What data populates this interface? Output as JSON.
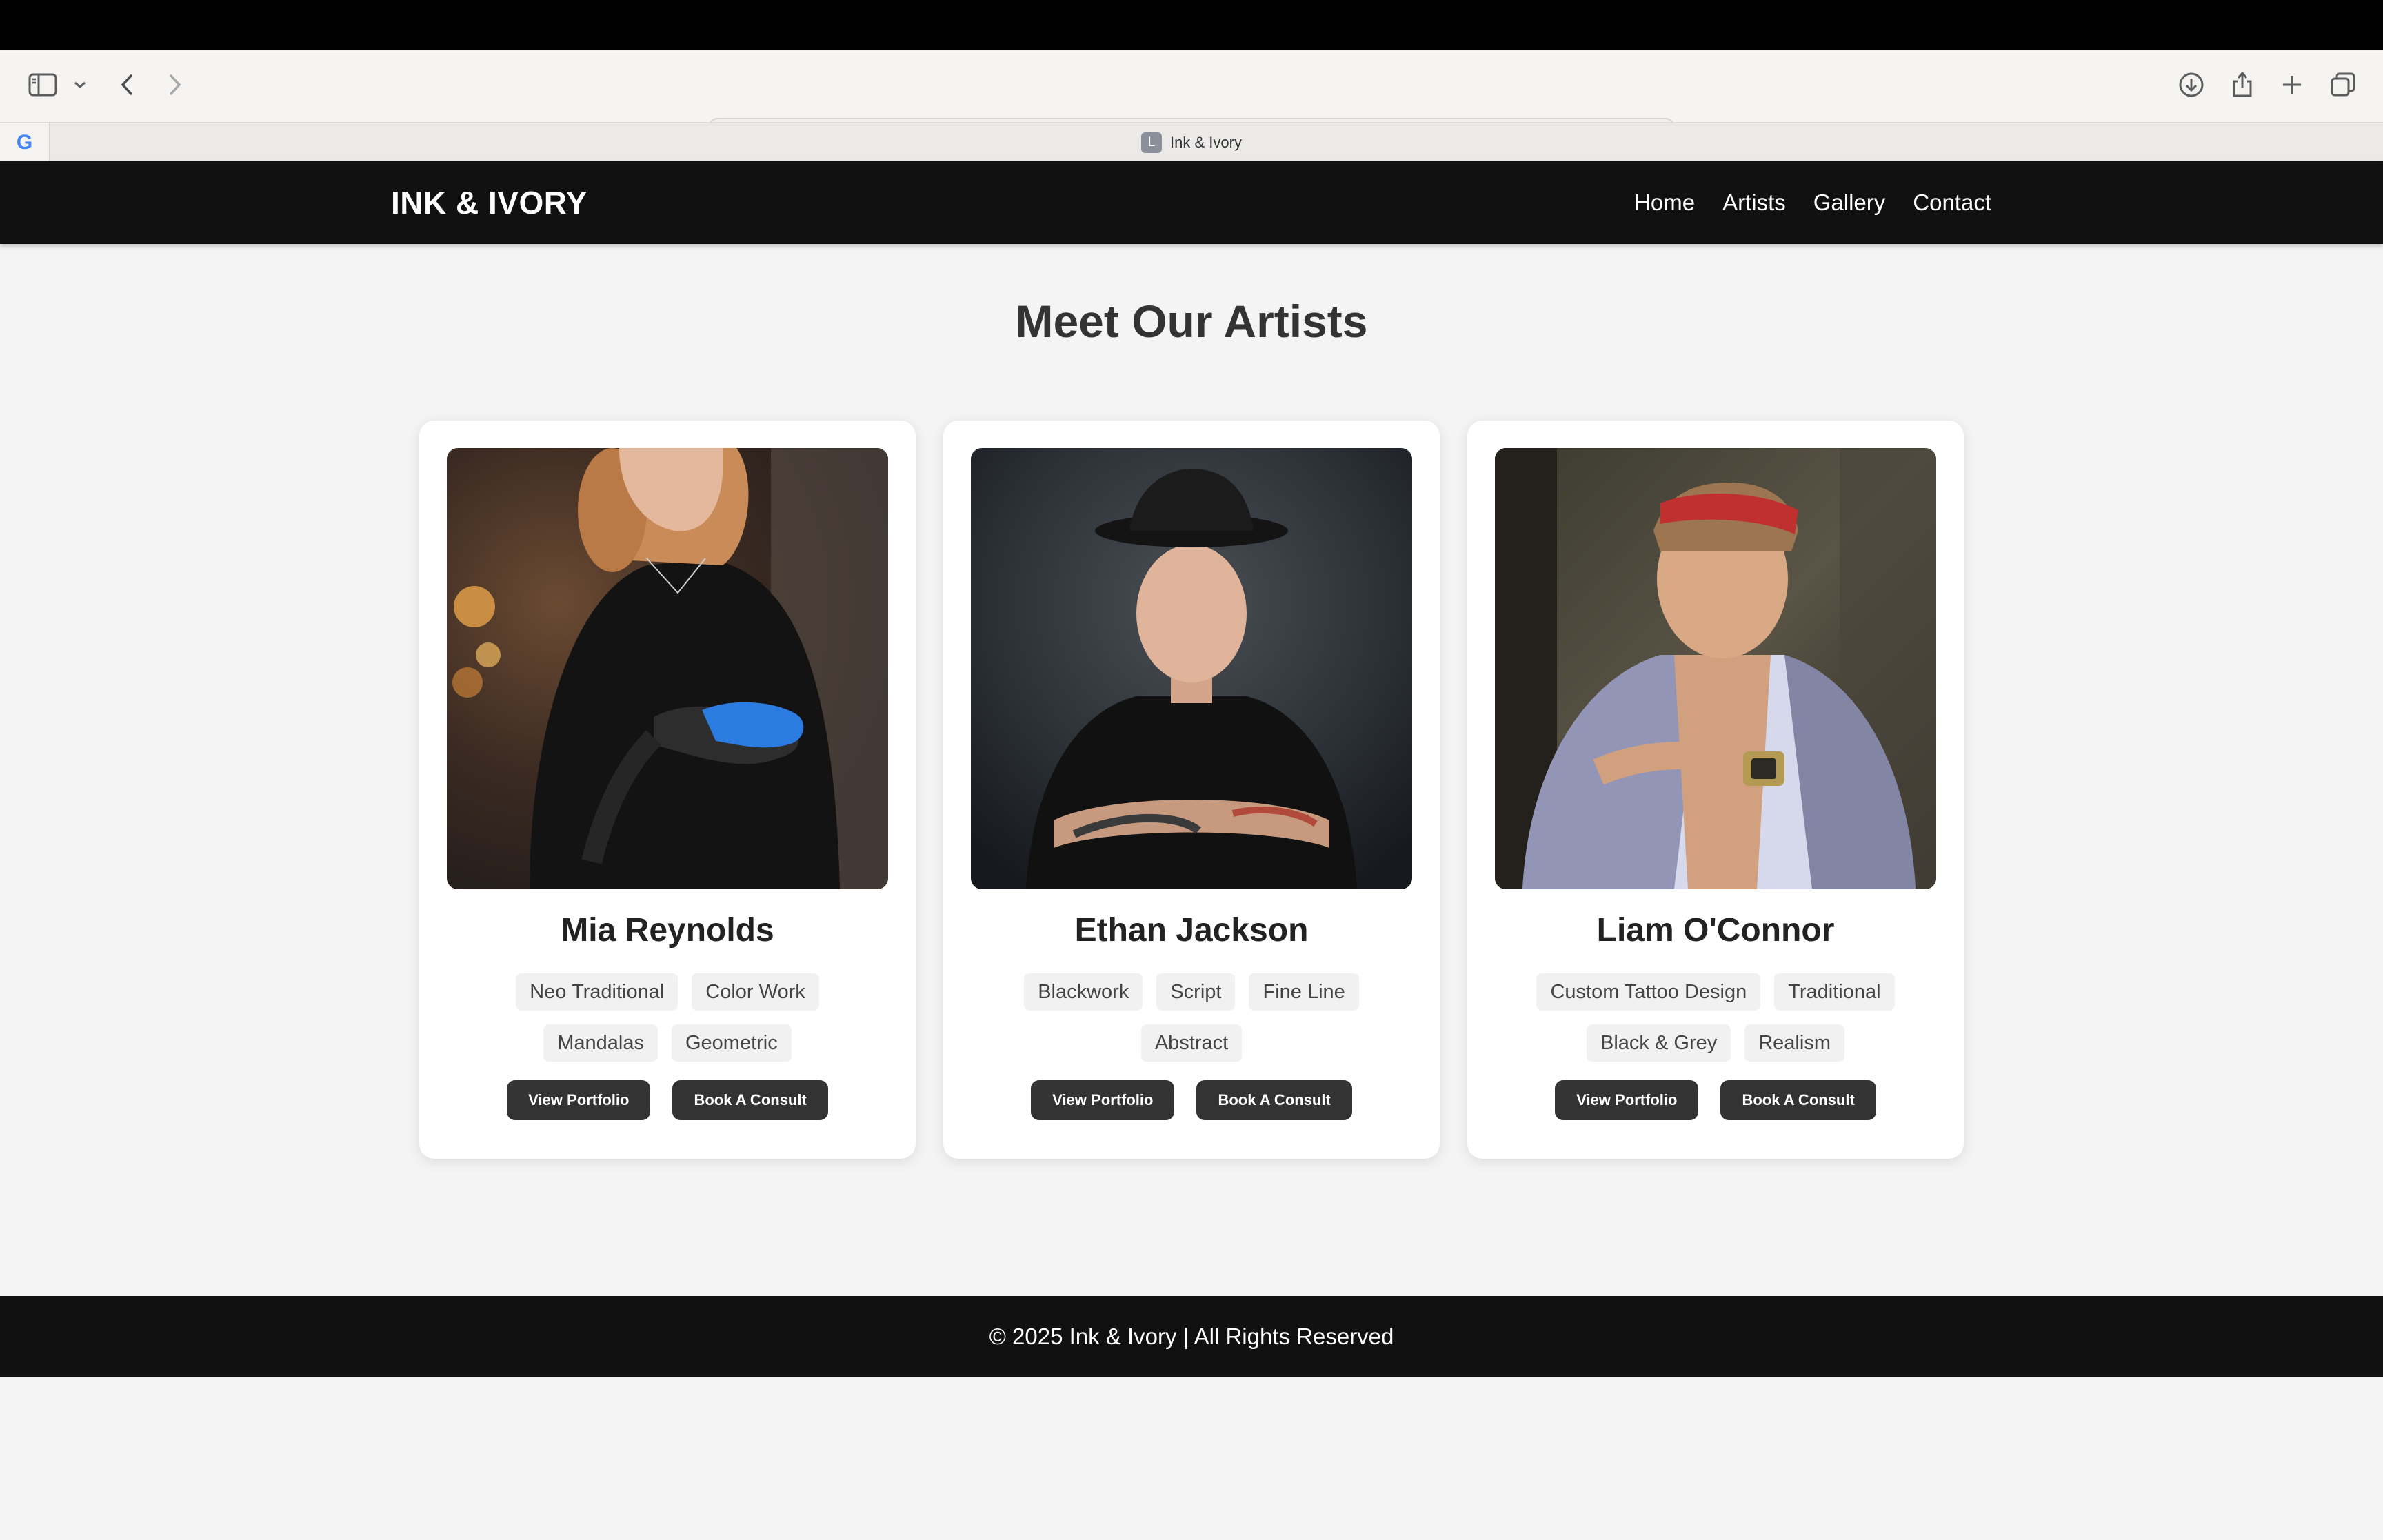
{
  "browser": {
    "url": "localhost",
    "google_tab": "G",
    "tab_favicon_letter": "L",
    "tab_title": "Ink & Ivory"
  },
  "header": {
    "logo": "INK & IVORY",
    "nav": [
      "Home",
      "Artists",
      "Gallery",
      "Contact"
    ]
  },
  "main": {
    "title": "Meet Our Artists",
    "artists": [
      {
        "name": "Mia Reynolds",
        "tags": [
          "Neo Traditional",
          "Color Work",
          "Mandalas",
          "Geometric"
        ],
        "photo": "woman-in-black-apron-blue-glove"
      },
      {
        "name": "Ethan Jackson",
        "tags": [
          "Blackwork",
          "Script",
          "Fine Line",
          "Abstract"
        ],
        "photo": "man-in-hat-arms-crossed"
      },
      {
        "name": "Liam O'Connor",
        "tags": [
          "Custom Tattoo Design",
          "Traditional",
          "Black & Grey",
          "Realism"
        ],
        "photo": "man-in-bandana-floral-shirt"
      }
    ],
    "buttons": {
      "portfolio": "View Portfolio",
      "consult": "Book A Consult"
    }
  },
  "footer": {
    "text": "© 2025 Ink & Ivory | All Rights Reserved"
  }
}
